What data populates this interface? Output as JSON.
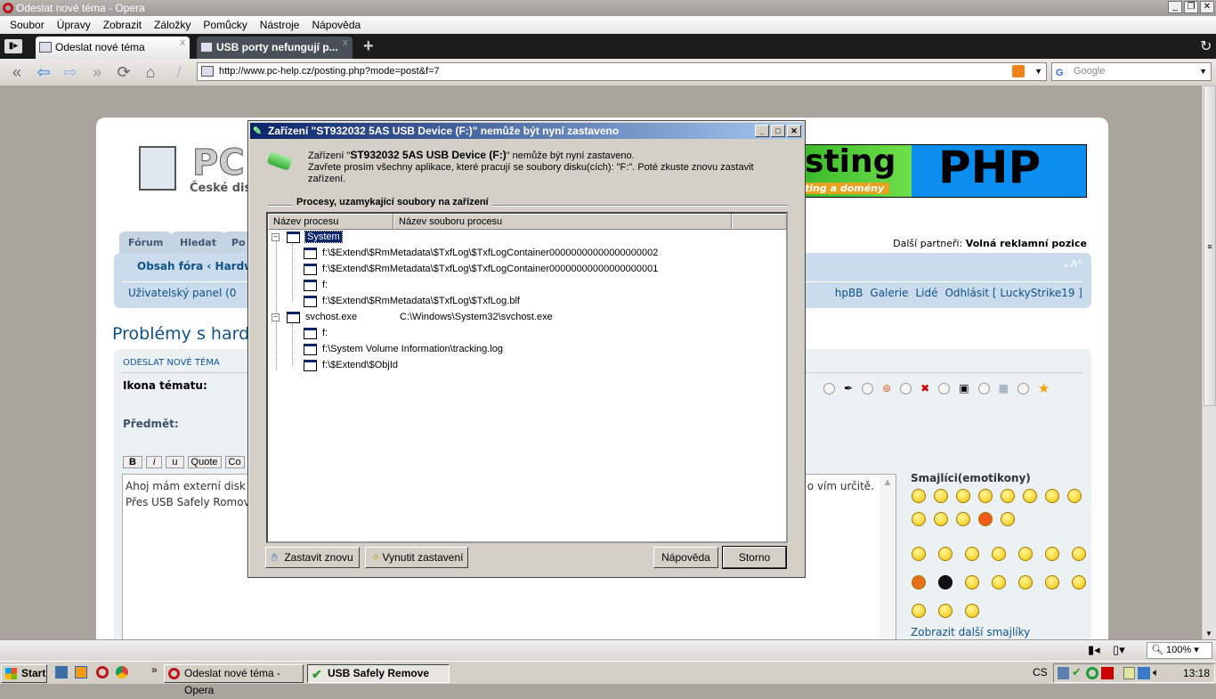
{
  "window": {
    "title": "Odeslat nové téma - Opera"
  },
  "menu": [
    "Soubor",
    "Úpravy",
    "Zobrazit",
    "Záložky",
    "Pomůcky",
    "Nástroje",
    "Nápověda"
  ],
  "tabs": [
    {
      "label": "Odeslat nové téma"
    },
    {
      "label": "USB porty nefungují p..."
    }
  ],
  "address": {
    "url": "http://www.pc-help.cz/posting.php?mode=post&f=7",
    "search_placeholder": "Google"
  },
  "site": {
    "logo_sub": "České dis",
    "banner_text": "sting",
    "banner_sub": "ting a domény",
    "banner_php": "PHP",
    "partners_label": "Další partneři:",
    "partners_value": "Volná reklamní pozice",
    "nav_tabs": [
      "Fórum",
      "Hledat",
      "Po"
    ],
    "breadcrumb": "Obsah fóra ‹ Hardw",
    "font_controls": "⌄A^",
    "user_panel": "Uživatelský panel (0",
    "user_links": [
      "hpBB",
      "Galerie",
      "Lidé",
      "Odhlásit [ LuckyStrike19 ]"
    ],
    "topic_title": "Problémy s hardv",
    "section_header": "ODESLAT NOVÉ TÉMA",
    "icon_label": "Ikona tématu:",
    "subject_label": "Předmět:",
    "editor_buttons": [
      "B",
      "i",
      "u",
      "Quote",
      "Co"
    ],
    "message_lines": [
      "Ahoj mám externí disk",
      "Přes USB Safely Romove"
    ],
    "message_tail": "o vím určitě.",
    "smilies_title": "Smajlíci(emotikony)",
    "more_smilies": "Zobrazit další smajlíky"
  },
  "dialog": {
    "title": "Zařízení \"ST932032 5AS USB Device (F:)\" nemůže být nyní zastaveno",
    "msg1_pre": "Zařízení \"",
    "msg1_bold": "ST932032 5AS USB Device (F:)",
    "msg1_post": "\" nemůže být nyní zastaveno.",
    "msg2": "Zavřete prosím všechny aplikace, které pracují se soubory disku(cích): \"F:\". Poté zkuste znovu zastavit zařízení.",
    "group_label": "Procesy, uzamykající soubory na zařízení",
    "columns": [
      "Název procesu",
      "Název souboru procesu"
    ],
    "processes": [
      {
        "name": "System",
        "file": "",
        "children": [
          "f:\\$Extend\\$RmMetadata\\$TxfLog\\$TxfLogContainer00000000000000000002",
          "f:\\$Extend\\$RmMetadata\\$TxfLog\\$TxfLogContainer00000000000000000001",
          "f:",
          "f:\\$Extend\\$RmMetadata\\$TxfLog\\$TxfLog.blf"
        ]
      },
      {
        "name": "svchost.exe",
        "file": "C:\\Windows\\System32\\svchost.exe",
        "children": [
          "f:",
          "f:\\System Volume Information\\tracking.log",
          "f:\\$Extend\\$ObjId"
        ]
      }
    ],
    "buttons": {
      "retry": "Zastavit znovu",
      "force": "Vynutit zastavení",
      "help": "Nápověda",
      "cancel": "Storno"
    }
  },
  "status": {
    "zoom": "100%"
  },
  "taskbar": {
    "start": "Start",
    "items": [
      "Odeslat nové téma - Opera",
      "USB Safely Remove"
    ],
    "lang": "CS",
    "clock": "13:18"
  }
}
